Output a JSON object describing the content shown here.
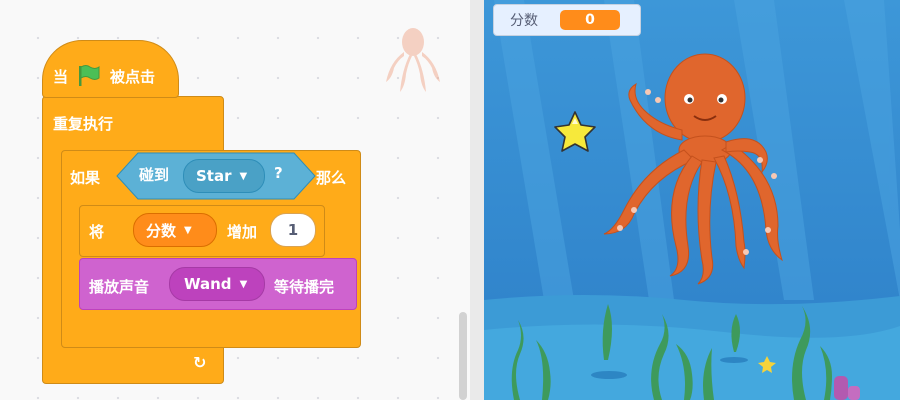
{
  "colors": {
    "event": "#ffab19",
    "control": "#ffab19",
    "operator": "#ff8c1a",
    "sound": "#cf63cf",
    "sensing": "#5cb1d6",
    "green_flag": "#4cbf56",
    "monitor_value": "#ff8c1a"
  },
  "blocks": {
    "hat": {
      "when": "当",
      "flag_icon": "green-flag-icon",
      "clicked": "被点击"
    },
    "forever": {
      "label": "重复执行"
    },
    "if": {
      "label_left": "如果",
      "label_right": "那么"
    },
    "touching": {
      "label": "碰到",
      "target": "Star",
      "question": "?"
    },
    "change_var": {
      "label": "将",
      "variable": "分数",
      "increase": "增加",
      "amount": "1"
    },
    "play_sound": {
      "label": "播放声音",
      "sound": "Wand",
      "until_done": "等待播完"
    }
  },
  "stage": {
    "monitor": {
      "label": "分数",
      "value": "0"
    },
    "sprites": [
      "octopus",
      "star"
    ]
  }
}
